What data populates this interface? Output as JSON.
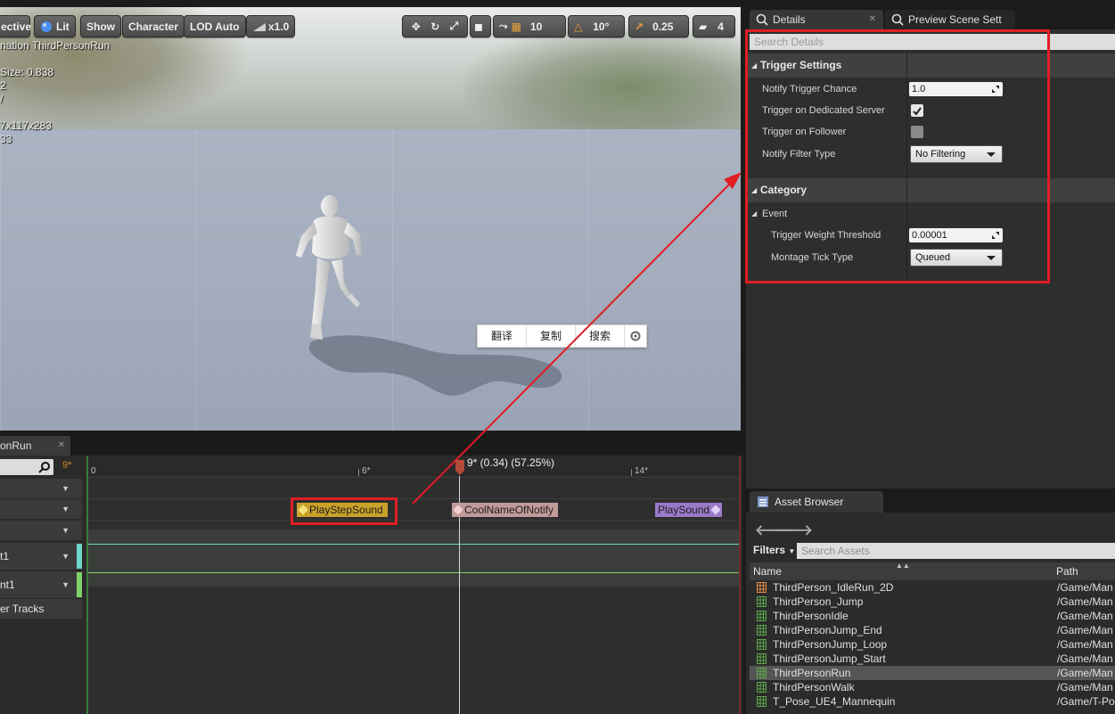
{
  "viewport": {
    "toolbar": {
      "perspective": "ective",
      "lit": "Lit",
      "show": "Show",
      "character": "Character",
      "lod": "LOD Auto",
      "speed": "x1.0",
      "grid_snap": "10",
      "rot_snap": "10°",
      "scale_snap": "0.25",
      "camera_speed": "4"
    },
    "stats": "nation ThirdPersonRun\n\nSize: 0.838\n2\n/\n\n7x117x283\n33",
    "context_menu": [
      "翻译",
      "复制",
      "搜索"
    ]
  },
  "timeline": {
    "tab_label": "onRun",
    "frame_indicator": "9*",
    "ruler": {
      "ticks": [
        "0",
        "6*",
        "14*"
      ],
      "playhead_label": "9* (0.34) (57.25%)"
    },
    "rows": [
      {
        "label": ""
      },
      {
        "label": ""
      },
      {
        "label": ""
      },
      {
        "label": "t1"
      },
      {
        "label": "nt1"
      },
      {
        "label": "er Tracks"
      }
    ],
    "notifies": [
      {
        "label": "PlayStepSound",
        "color": "#c9a22a"
      },
      {
        "label": "CoolNameOfNotify",
        "color": "#c29a9a"
      },
      {
        "label": "PlaySound",
        "color": "#9a7ac8"
      }
    ]
  },
  "details": {
    "tabs": [
      "Details",
      "Preview Scene Sett"
    ],
    "search_placeholder": "Search Details",
    "trigger_settings": {
      "title": "Trigger Settings",
      "notify_trigger_chance_label": "Notify Trigger Chance",
      "notify_trigger_chance_value": "1.0",
      "trigger_dedicated_label": "Trigger on Dedicated Server",
      "trigger_dedicated_checked": true,
      "trigger_follower_label": "Trigger on Follower",
      "trigger_follower_checked": false,
      "filter_type_label": "Notify Filter Type",
      "filter_type_value": "No Filtering"
    },
    "category": {
      "title": "Category",
      "event_label": "Event",
      "weight_threshold_label": "Trigger Weight Threshold",
      "weight_threshold_value": "0.00001",
      "montage_tick_label": "Montage Tick Type",
      "montage_tick_value": "Queued"
    }
  },
  "asset_browser": {
    "tab_label": "Asset Browser",
    "filters_label": "Filters",
    "search_placeholder": "Search Assets",
    "columns": {
      "name": "Name",
      "path": "Path"
    },
    "assets": [
      {
        "name": "ThirdPerson_IdleRun_2D",
        "path": "/Game/Man",
        "type": "blendspace"
      },
      {
        "name": "ThirdPerson_Jump",
        "path": "/Game/Man",
        "type": "anim"
      },
      {
        "name": "ThirdPersonIdle",
        "path": "/Game/Man",
        "type": "anim"
      },
      {
        "name": "ThirdPersonJump_End",
        "path": "/Game/Man",
        "type": "anim"
      },
      {
        "name": "ThirdPersonJump_Loop",
        "path": "/Game/Man",
        "type": "anim"
      },
      {
        "name": "ThirdPersonJump_Start",
        "path": "/Game/Man",
        "type": "anim"
      },
      {
        "name": "ThirdPersonRun",
        "path": "/Game/Man",
        "type": "anim",
        "selected": true
      },
      {
        "name": "ThirdPersonWalk",
        "path": "/Game/Man",
        "type": "anim"
      },
      {
        "name": "T_Pose_UE4_Mannequin",
        "path": "/Game/T-Po",
        "type": "anim"
      }
    ]
  },
  "colors": {
    "highlight_red": "#e01e24",
    "accent_orange": "#d48a24"
  }
}
